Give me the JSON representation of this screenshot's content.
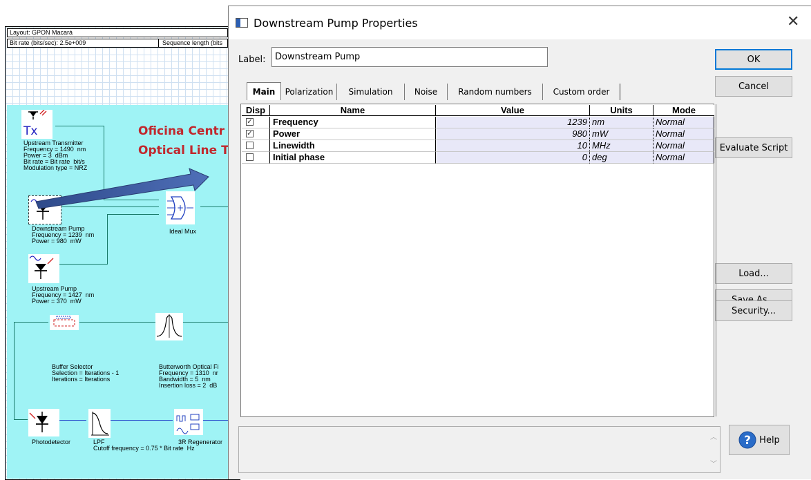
{
  "layout": {
    "title": "Layout: GPON Macará",
    "bitrate_label": "Bit rate (bits/sec):  2.5e+009",
    "seqlen_label": "Sequence length (bits"
  },
  "canvas": {
    "overlay_line1": "Oficina Centr",
    "overlay_line2": "Optical Line T",
    "upstream_tx": {
      "icon_text": "Tx",
      "label": "Upstream Transmitter\nFrequency = 1490  nm\nPower = 3  dBm\nBit rate = Bit rate  bit/s\nModulation type = NRZ"
    },
    "downstream_pump": {
      "label": "Downstream Pump\nFrequency = 1239  nm\nPower = 980  mW"
    },
    "ideal_mux": {
      "label": "Ideal Mux"
    },
    "upstream_pump": {
      "label": "Upstream Pump\nFrequency = 1427  nm\nPower = 370  mW"
    },
    "buffer_selector": {
      "label": "Buffer Selector\nSelection = Iterations - 1\nIterations = Iterations"
    },
    "butterworth": {
      "label": "Butterworth Optical Fi\nFrequency = 1310  nr\nBandwidth = 5  nm\nInsertion loss = 2  dB"
    },
    "photodetector": {
      "label": "Photodetector"
    },
    "lpf": {
      "label": "LPF\nCutoff frequency = 0.75 * Bit rate  Hz"
    },
    "regenerator": {
      "label": "3R Regenerator"
    }
  },
  "dialog": {
    "title": "Downstream Pump Properties",
    "label_caption": "Label:",
    "label_value": "Downstream Pump",
    "buttons": {
      "ok": "OK",
      "cancel": "Cancel",
      "evaluate": "Evaluate Script",
      "load": "Load...",
      "save_as": "Save As...",
      "security": "Security...",
      "help": "Help"
    },
    "tabs": [
      "Main",
      "Polarization",
      "Simulation",
      "Noise",
      "Random numbers",
      "Custom order"
    ],
    "active_tab": "Main",
    "columns": [
      "Disp",
      "Name",
      "Value",
      "Units",
      "Mode"
    ],
    "rows": [
      {
        "disp": true,
        "name": "Frequency",
        "value": "1239",
        "units": "nm",
        "mode": "Normal"
      },
      {
        "disp": true,
        "name": "Power",
        "value": "980",
        "units": "mW",
        "mode": "Normal"
      },
      {
        "disp": false,
        "name": "Linewidth",
        "value": "10",
        "units": "MHz",
        "mode": "Normal"
      },
      {
        "disp": false,
        "name": "Initial phase",
        "value": "0",
        "units": "deg",
        "mode": "Normal"
      }
    ]
  }
}
